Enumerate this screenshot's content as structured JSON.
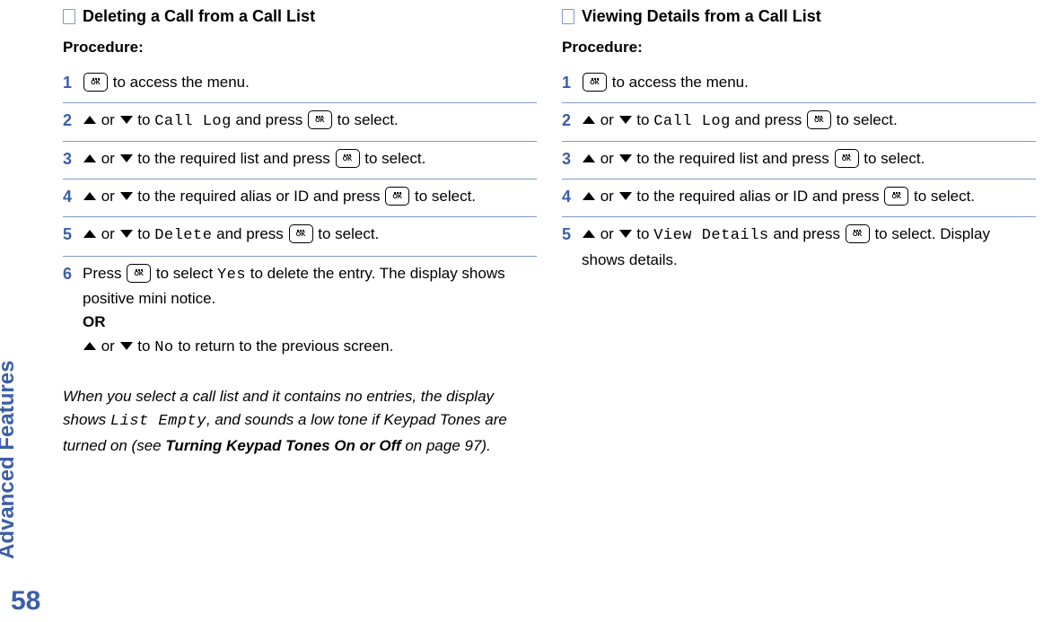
{
  "sidebar": {
    "vertical_label": "Advanced Features",
    "page_number": "58"
  },
  "labels": {
    "procedure": "Procedure:",
    "or_sep": "OR"
  },
  "key": {
    "ok": "OK"
  },
  "text": {
    "or": " or ",
    "to": " to ",
    "to_access_menu": " to access the menu.",
    "and_press": " and press ",
    "to_select": " to select.",
    "to_req_list": " to the required list and press ",
    "to_req_alias": " to the required alias or ID and press ",
    "press": "Press ",
    "to_select_yes_prefix": " to select ",
    "to_delete_entry_suffix": " to delete the entry. The display shows positive mini notice.",
    "to_no_suffix": " to return to the previous screen.",
    "display_shows_details": " to select. Display shows details."
  },
  "mono": {
    "call_log": "Call Log",
    "delete": "Delete",
    "yes": "Yes",
    "no": "No",
    "view_details": "View Details",
    "list_empty": "List Empty"
  },
  "left": {
    "title": "Deleting a Call from a Call List",
    "note_pre": "When you select a call list and it contains no entries, the display shows ",
    "note_mid": ", and sounds a low tone if Keypad Tones are turned on (see ",
    "note_ref": "Turning Keypad Tones On or Off",
    "note_post": " on page 97)."
  },
  "right": {
    "title": "Viewing Details from a Call List"
  },
  "step_nums": {
    "s1": "1",
    "s2": "2",
    "s3": "3",
    "s4": "4",
    "s5": "5",
    "s6": "6"
  }
}
